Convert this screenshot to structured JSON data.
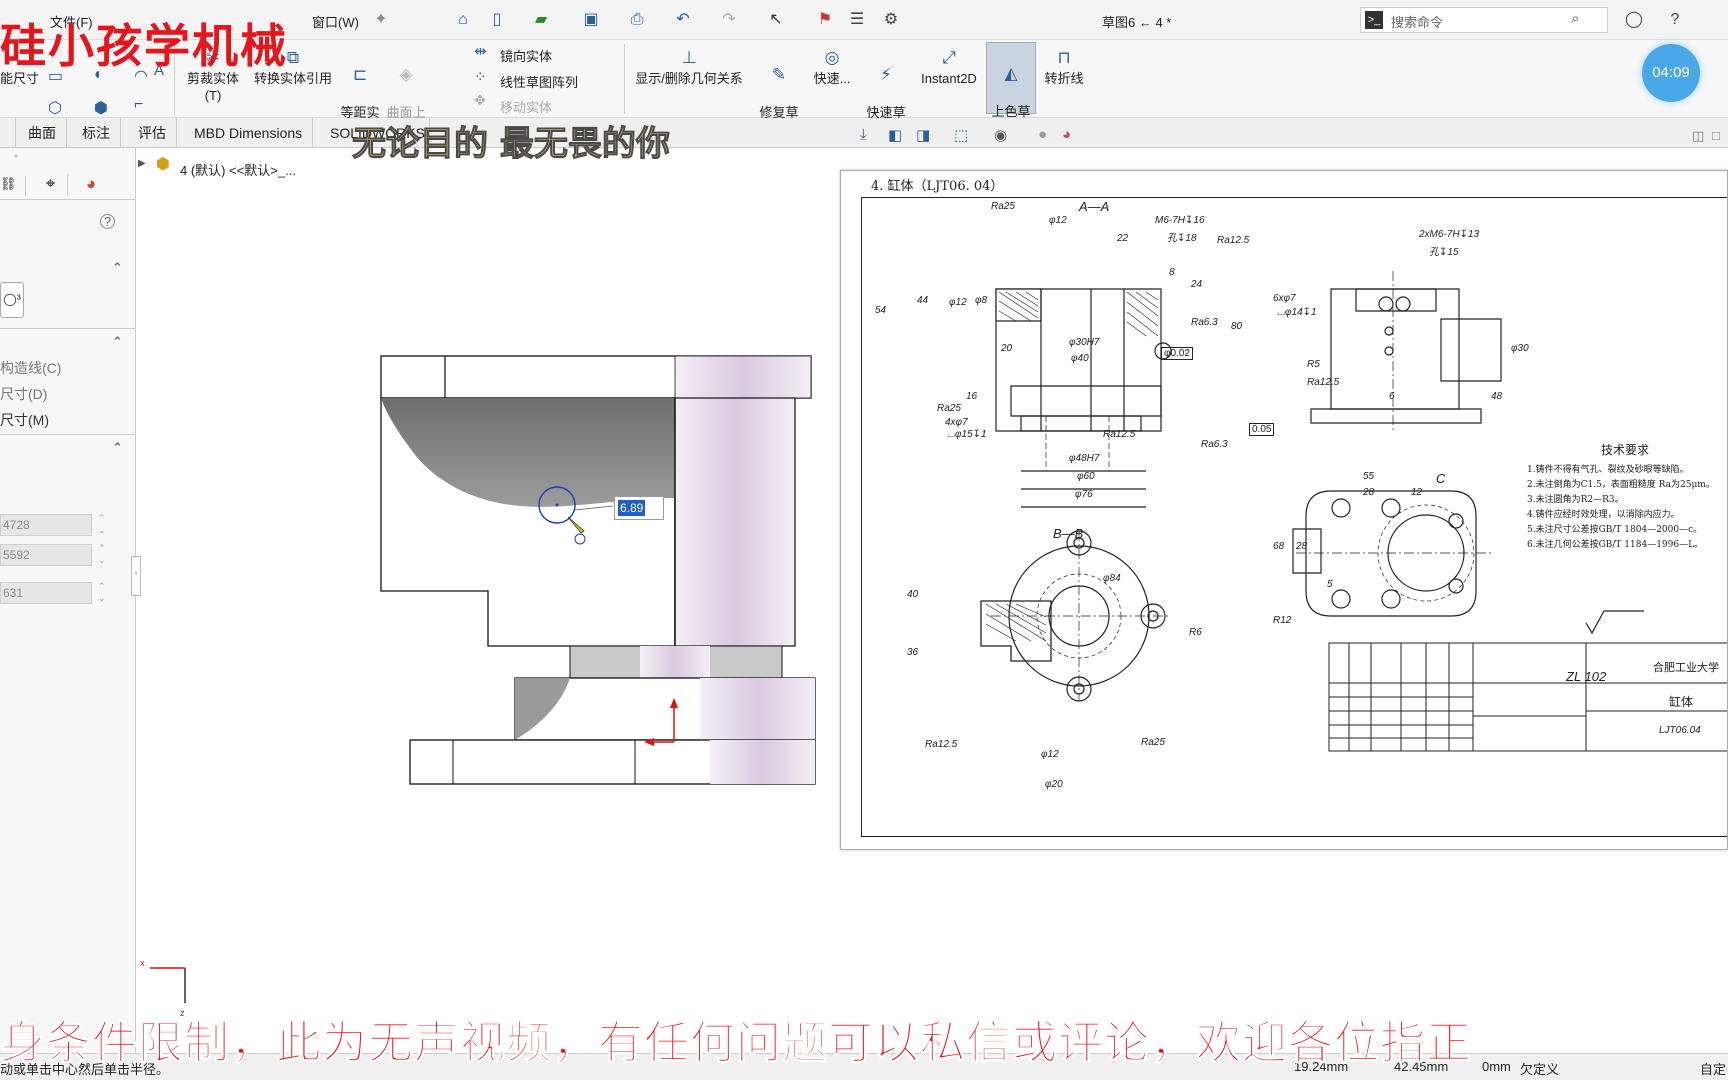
{
  "overlay": {
    "channel_name": "硅小孩学机械",
    "motto": "无论目的 最无畏的你",
    "banner": "身条件限制，此为无声视频，有任何问题可以私信或评论，欢迎各位指正",
    "timer": "04:09"
  },
  "topbar": {
    "menu": [
      "文件(F)",
      "窗口(W)"
    ],
    "document_title": "草图6 ← 4 *",
    "search_placeholder": "搜索命令"
  },
  "ribbon": {
    "smart_dimension": "能尺寸",
    "trim": "剪裁实体(T)",
    "convert": "转换实体引用",
    "offset": "等距实\n体",
    "surface_offset": "曲面上\n偏移",
    "mirror": "镜向实体",
    "linear_pattern": "线性草图阵列",
    "move": "移动实体",
    "display_relations": "显示/删除几何关系",
    "repair": "修复草\n图",
    "quick_snap": "快速...",
    "rapid_sketch": "快速草\n图",
    "instant2d": "Instant2D",
    "shaded_contours": "上色草\n图轮廓",
    "jog_line": "转折线"
  },
  "tabs": [
    "曲面",
    "标注",
    "评估",
    "MBD Dimensions",
    "SOLIDWORKS 插件"
  ],
  "tree": {
    "root_label": "4 (默认) <<默认>_..."
  },
  "leftpanel": {
    "items": [
      "构造线(C)",
      "尺寸(D)",
      "尺寸(M)"
    ],
    "fields": [
      "4728",
      "5592",
      "631"
    ],
    "help": "?"
  },
  "viewport": {
    "dimension_value": "6.89"
  },
  "drawing": {
    "title": "4. 缸体（LJT06. 04）",
    "tech_title": "技术要求",
    "tech_lines": [
      "1.铸件不得有气孔、裂纹及砂眼等缺陷。",
      "2.未注倒角为C1.5，表面粗糙度 Ra为25μm。",
      "3.未注圆角为R2—R3。",
      "4.铸件应经时效处理，以消除内应力。",
      "5.未注尺寸公差按GB/T 1804—2000—c。",
      "6.未注几何公差按GB/T 1184—1996—L。"
    ],
    "section_aa": "A—A",
    "section_bb": "B—B",
    "view_c": "C",
    "material": "ZL 102",
    "school": "合肥工业大学",
    "part_name": "缸体",
    "part_code": "LJT06.04",
    "dims": [
      "Ra25",
      "φ12",
      "M6-7H↧16",
      "孔↧18",
      "Ra12.5",
      "22",
      "8",
      "24",
      "80",
      "54",
      "44",
      "φ12",
      "φ8",
      "Ra6.3",
      "φ30H7",
      "φ40",
      "20",
      "16",
      "φ0.02",
      "Ra25",
      "4xφ7",
      "⌴φ15↧1",
      "Ra12.5",
      "φ48H7",
      "φ60",
      "φ76",
      "Ra6.3",
      "0.05",
      "2xM6-7H↧13",
      "孔↧15",
      "6xφ7",
      "⌴φ14↧1",
      "R5",
      "Ra12.5",
      "φ30",
      "48",
      "6",
      "55",
      "28",
      "12",
      "68",
      "28",
      "5",
      "R12",
      "φ84",
      "40",
      "36",
      "R6",
      "φ12",
      "φ20",
      "Ra12.5",
      "Ra25"
    ]
  },
  "status": {
    "hint": "动或单击中心然后单击半径。",
    "x": "19.24mm",
    "y": "42.45mm",
    "z": "0mm",
    "state": "欠定义",
    "right": "自定"
  }
}
